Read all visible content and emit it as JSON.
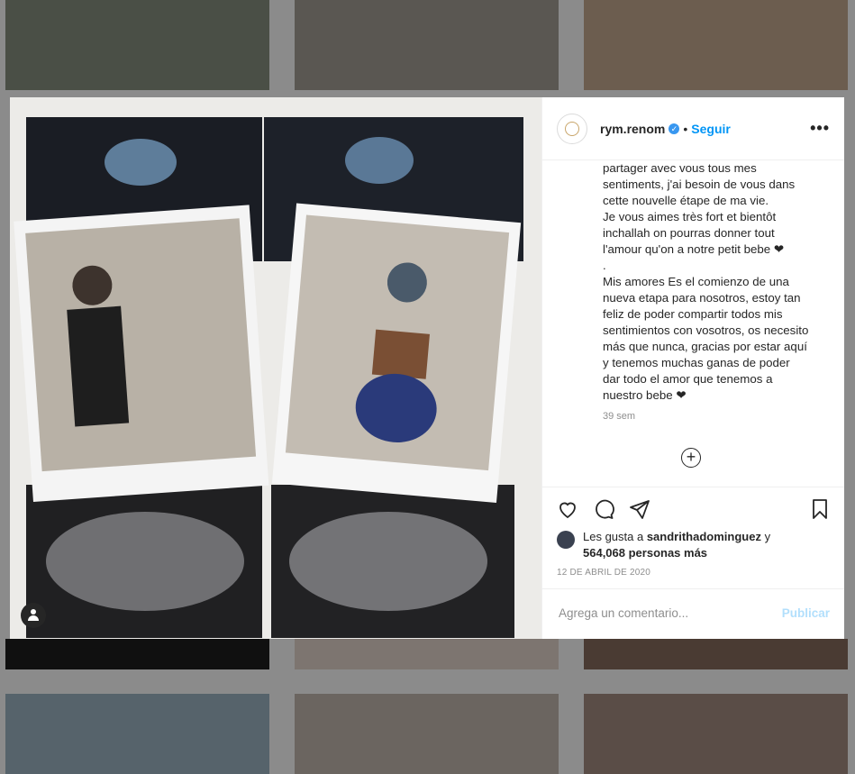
{
  "post": {
    "username": "rym.renom",
    "verified_mark": "✓",
    "separator": "•",
    "follow_label": "Seguir",
    "more_label": "•••",
    "caption_lines": [
      "partager avec vous tous mes",
      "sentiments, j'ai besoin de vous dans",
      "cette nouvelle étape de ma vie.",
      "Je vous aimes très fort et bientôt",
      "inchallah on pourras donner tout",
      "l'amour qu'on a notre petit bebe ❤",
      ".",
      "Mis amores Es el comienzo de una",
      "nueva etapa para nosotros, estoy tan",
      "feliz de poder compartir todos mis",
      "sentimientos con vosotros, os necesito",
      "más que nunca, gracias por estar aquí",
      "y tenemos muchas ganas de poder",
      "dar todo el amor que tenemos a",
      "nuestro bebe ❤"
    ],
    "caption_time": "39 sem",
    "load_more_label": "+",
    "likes_prefix": "Les gusta a ",
    "likes_user": "sandrithadominguez",
    "likes_suffix": " y",
    "likes_count": "564,068 personas más",
    "date": "12 DE ABRIL DE 2020",
    "comment_placeholder": "Agrega un comentario...",
    "publish_label": "Publicar"
  },
  "icons": {
    "like": "heart-icon",
    "comment": "comment-icon",
    "share": "share-icon",
    "save": "bookmark-icon",
    "tag": "user-tag-icon"
  },
  "colors": {
    "accent": "#0095f6",
    "verified": "#3897f0",
    "publish_disabled": "#b2dffc"
  }
}
